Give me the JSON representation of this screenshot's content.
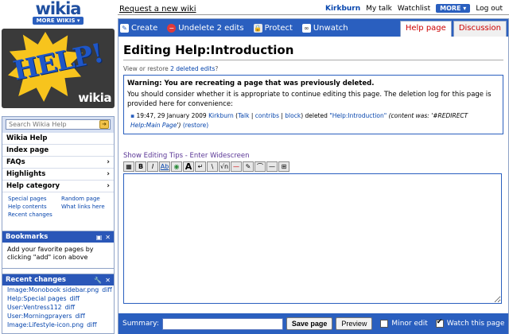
{
  "topbar": {
    "logo_text": "wikia",
    "more_wikis": "MORE WIKIS ▾",
    "request_link": "Request a new wiki",
    "user": "Kirkburn",
    "my_talk": "My talk",
    "watchlist": "Watchlist",
    "more": "MORE ▾",
    "logout": "Log out"
  },
  "sidebar": {
    "help_logo_text": "HELP!",
    "help_logo_wikia": "wikia",
    "search_placeholder": "Search Wikia Help",
    "nav": [
      {
        "label": "Wikia Help",
        "chevron": ""
      },
      {
        "label": "Index page",
        "chevron": ""
      },
      {
        "label": "FAQs",
        "chevron": "›"
      },
      {
        "label": "Highlights",
        "chevron": "›"
      },
      {
        "label": "Help category",
        "chevron": "›"
      }
    ],
    "quicklinks": [
      "Special pages",
      "Random page",
      "Help contents",
      "What links here",
      "Recent changes"
    ]
  },
  "bookmarks": {
    "title": "Bookmarks",
    "body": "Add your favorite pages by clicking \"add\" icon above"
  },
  "recent_changes": {
    "title": "Recent changes",
    "items": [
      {
        "page": "Image:Monobook sidebar.png",
        "diff": "diff"
      },
      {
        "page": "Help:Special pages",
        "diff": "diff"
      },
      {
        "page": "User:Ventress112",
        "diff": "diff"
      },
      {
        "page": "User:Morningprayers",
        "diff": "diff"
      },
      {
        "page": "Image:Lifestyle-icon.png",
        "diff": "diff"
      }
    ]
  },
  "actions": {
    "create": "Create",
    "undelete": "Undelete 2 edits",
    "protect": "Protect",
    "unwatch": "Unwatch"
  },
  "tabs": {
    "help_page": "Help page",
    "discussion": "Discussion"
  },
  "page": {
    "heading": "Editing Help:Introduction",
    "subtitle_prefix": "View or restore ",
    "subtitle_link": "2 deleted edits",
    "subtitle_suffix": "?"
  },
  "warning": {
    "title": "Warning: You are recreating a page that was previously deleted.",
    "body": "You should consider whether it is appropriate to continue editing this page. The deletion log for this page is provided here for convenience:",
    "log_time": "19:47, 29 January 2009",
    "log_user": "Kirkburn",
    "log_talk": "Talk",
    "log_contribs": "contribs",
    "log_block": "block",
    "log_action": "deleted",
    "log_page": "\"Help:Introduction\"",
    "log_reason_prefix": "(content was: '#REDIRECT ",
    "log_reason_link": "Help:Main Page",
    "log_reason_suffix": "')",
    "log_restore": "(restore)"
  },
  "editor": {
    "tips": "Show Editing Tips",
    "separator": " - ",
    "widescreen": "Enter Widescreen",
    "toolbar_buttons": [
      "▦",
      "B",
      "I",
      "Ab",
      "◉",
      "A",
      "↵",
      "\\",
      "√n",
      "—",
      "✎",
      "⌒",
      "—",
      "⊞"
    ]
  },
  "savebar": {
    "summary_label": "Summary:",
    "save": "Save page",
    "preview": "Preview",
    "minor_edit": "Minor edit",
    "watch": "Watch this page"
  },
  "colors": {
    "accent_blue": "#2a5fbf",
    "tab_red": "#cc0000",
    "logo_yellow": "#f7c41d"
  }
}
